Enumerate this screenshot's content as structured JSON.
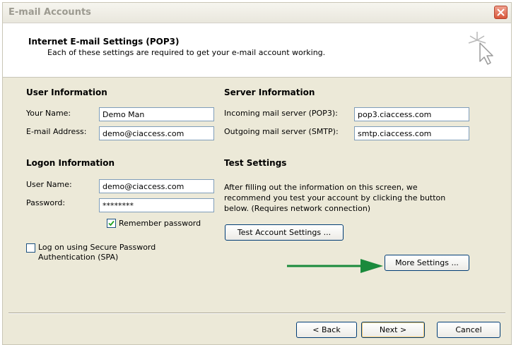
{
  "window": {
    "title": "E-mail Accounts"
  },
  "header": {
    "title": "Internet E-mail Settings (POP3)",
    "subtitle": "Each of these settings are required to get your e-mail account working."
  },
  "user_info": {
    "heading": "User Information",
    "name_label": "Your Name:",
    "name_value": "Demo Man",
    "email_label": "E-mail Address:",
    "email_value": "demo@ciaccess.com"
  },
  "logon_info": {
    "heading": "Logon Information",
    "user_label": "User Name:",
    "user_value": "demo@ciaccess.com",
    "password_label": "Password:",
    "password_value": "********",
    "remember_label": "Remember password",
    "remember_checked": true,
    "spa_label_line1": "Log on using Secure Password",
    "spa_label_line2": "Authentication (SPA)",
    "spa_checked": false
  },
  "server_info": {
    "heading": "Server Information",
    "incoming_label": "Incoming mail server (POP3):",
    "incoming_value": "pop3.ciaccess.com",
    "outgoing_label": "Outgoing mail server (SMTP):",
    "outgoing_value": "smtp.ciaccess.com"
  },
  "test_settings": {
    "heading": "Test Settings",
    "description": "After filling out the information on this screen, we recommend you test your account by clicking the button below. (Requires network connection)",
    "test_button": "Test Account Settings ...",
    "more_button": "More Settings ..."
  },
  "footer": {
    "back_button": "< Back",
    "next_button": "Next >",
    "cancel_button": "Cancel"
  },
  "colors": {
    "arrow": "#1a8a3c",
    "dialog_bg": "#ece9d8",
    "field_border": "#7f9db9",
    "button_border": "#003c74"
  },
  "icons": {
    "close": "close-icon",
    "wizard": "cursor-sparkle-icon",
    "arrow": "arrow-right-icon",
    "check": "checkmark-icon"
  }
}
